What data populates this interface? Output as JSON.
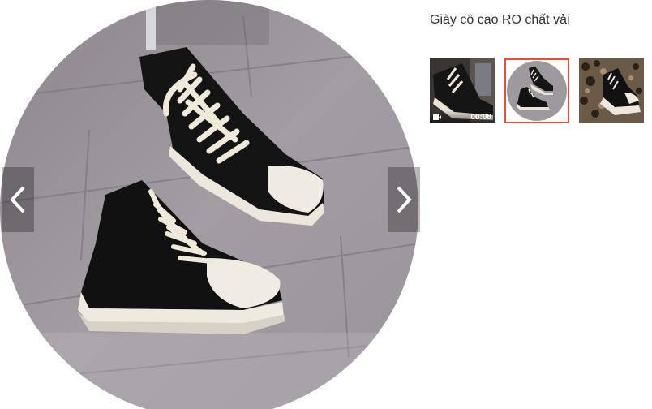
{
  "product": {
    "title": "Giày cô cao RO chất vải"
  },
  "gallery": {
    "prev_icon": "chevron-left-icon",
    "next_icon": "chevron-right-icon",
    "selected_index": 1,
    "thumbnails": [
      {
        "type": "video",
        "duration": "00:08",
        "icon": "video-camera-icon"
      },
      {
        "type": "image"
      },
      {
        "type": "image"
      }
    ]
  },
  "colors": {
    "accent": "#ee4d2d",
    "title_text": "#333333"
  }
}
